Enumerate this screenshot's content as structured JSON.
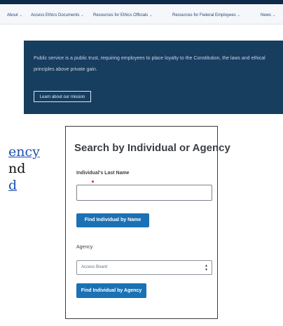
{
  "site": {
    "nav": [
      {
        "label": "About",
        "chevron": "⌄"
      },
      {
        "label": "Access Ethics Documents",
        "chevron": "⌄"
      },
      {
        "label": "Resources for Ethics Officials",
        "chevron": "⌄"
      },
      {
        "label": "Resources for Federal Employees",
        "chevron": "⌄"
      },
      {
        "label": "News",
        "chevron": "⌄"
      }
    ],
    "hero": {
      "text": "Public service is a public trust, requiring employees to place loyalty to the Constitution, the laws and ethical principles above private gain.",
      "button_label": "Learn about our mission"
    }
  },
  "side_text": {
    "line1": "ency",
    "line2": "nd",
    "line3": "d"
  },
  "search_card": {
    "title": "Search by Individual or Agency",
    "name_label": "Individual's Last Name",
    "name_value": "",
    "name_button": "Find Individual by Name",
    "agency_label": "Agency",
    "agency_value": "Access Board",
    "agency_button": "Find Individual by Agency"
  },
  "colors": {
    "nav_bg": "#f5f7fa",
    "hero_bg": "#173d5f",
    "button_bg": "#1a71b4",
    "link": "#1b4fb0"
  }
}
